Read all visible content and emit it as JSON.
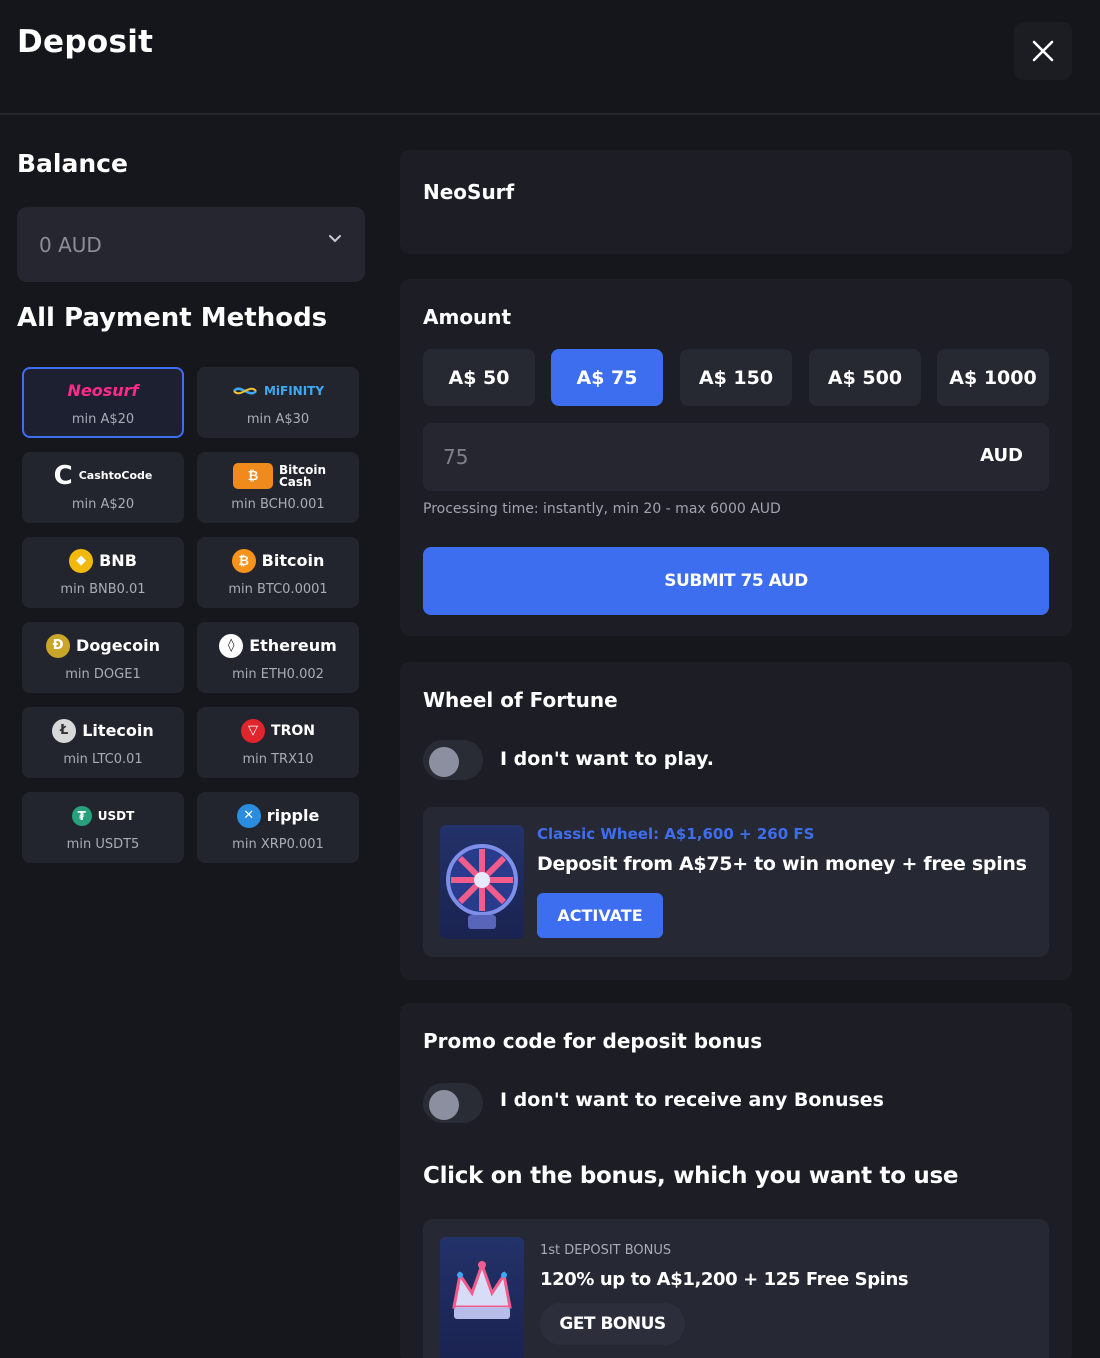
{
  "header": {
    "title": "Deposit",
    "close_icon": "close-icon"
  },
  "balance": {
    "heading": "Balance",
    "value": "0 AUD"
  },
  "payment_methods": {
    "heading": "All Payment Methods",
    "items": [
      {
        "name": "Neosurf",
        "min": "min A$20",
        "selected": true
      },
      {
        "name": "MiFINITY",
        "min": "min A$30"
      },
      {
        "name": "CashtoCode",
        "min": "min A$20"
      },
      {
        "name": "Bitcoin Cash",
        "min": "min BCH0.001"
      },
      {
        "name": "BNB",
        "min": "min BNB0.01"
      },
      {
        "name": "Bitcoin",
        "min": "min BTC0.0001"
      },
      {
        "name": "Dogecoin",
        "min": "min DOGE1"
      },
      {
        "name": "Ethereum",
        "min": "min ETH0.002"
      },
      {
        "name": "Litecoin",
        "min": "min LTC0.01"
      },
      {
        "name": "TRON",
        "min": "min TRX10"
      },
      {
        "name": "USDT",
        "min": "min USDT5"
      },
      {
        "name": "ripple",
        "min": "min XRP0.001"
      }
    ]
  },
  "selected_method": {
    "title": "NeoSurf"
  },
  "amount": {
    "heading": "Amount",
    "presets": [
      "A$ 50",
      "A$ 75",
      "A$ 150",
      "A$ 500",
      "A$ 1000"
    ],
    "active_preset": "A$ 75",
    "input_value": "75",
    "currency": "AUD",
    "processing": "Processing time: instantly, min 20 - max 6000 AUD",
    "submit_label": "SUBMIT 75 AUD"
  },
  "wheel": {
    "heading": "Wheel of Fortune",
    "toggle_label": "I don't want to play.",
    "promo_title": "Classic Wheel: A$1,600 + 260 FS",
    "promo_desc": "Deposit from A$75+ to win money + free spins",
    "activate_label": "ACTIVATE"
  },
  "promo": {
    "heading": "Promo code for deposit bonus",
    "toggle_label": "I don't want to receive any Bonuses",
    "click_text": "Click on the bonus, which you want to use",
    "bonus_kicker": "1st DEPOSIT BONUS",
    "bonus_title": "120% up to A$1,200 + 125 Free Spins",
    "bonus_button": "GET BONUS"
  },
  "colors": {
    "accent": "#3d6ef0",
    "background": "#16171c",
    "card": "#1d1e25",
    "wheel_promo_title": "#3d6ef0"
  }
}
